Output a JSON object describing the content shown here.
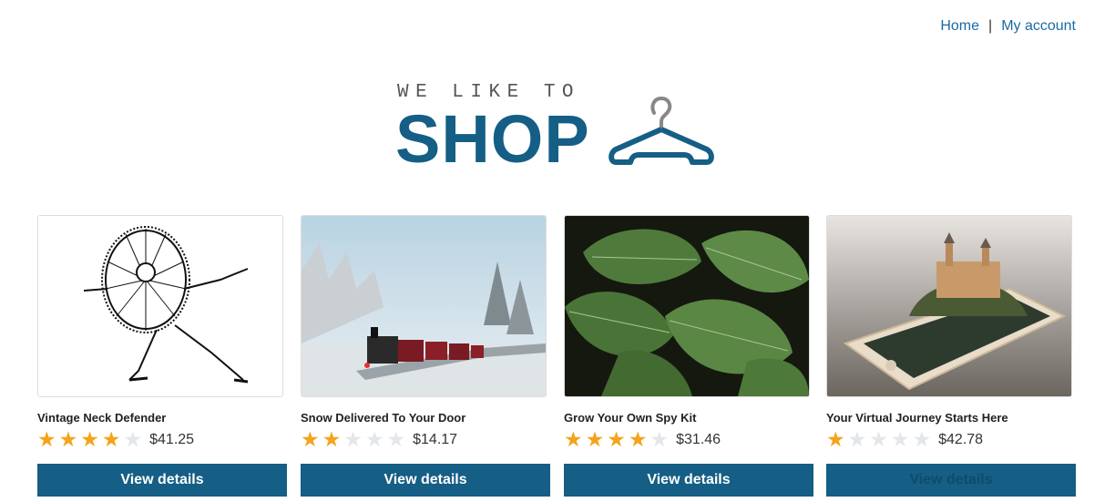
{
  "nav": {
    "home": "Home",
    "separator": "|",
    "account": "My account"
  },
  "logo": {
    "tagline": "WE LIKE TO",
    "word": "SHOP"
  },
  "products": [
    {
      "title": "Vintage Neck Defender",
      "rating": 4,
      "price": "$41.25",
      "button": "View details"
    },
    {
      "title": "Snow Delivered To Your Door",
      "rating": 2,
      "price": "$14.17",
      "button": "View details"
    },
    {
      "title": "Grow Your Own Spy Kit",
      "rating": 4,
      "price": "$31.46",
      "button": "View details"
    },
    {
      "title": "Your Virtual Journey Starts Here",
      "rating": 1,
      "price": "$42.78",
      "button": "View details"
    }
  ],
  "colors": {
    "brand": "#155e85",
    "link": "#1a6aa6",
    "star": "#f4a31b"
  }
}
